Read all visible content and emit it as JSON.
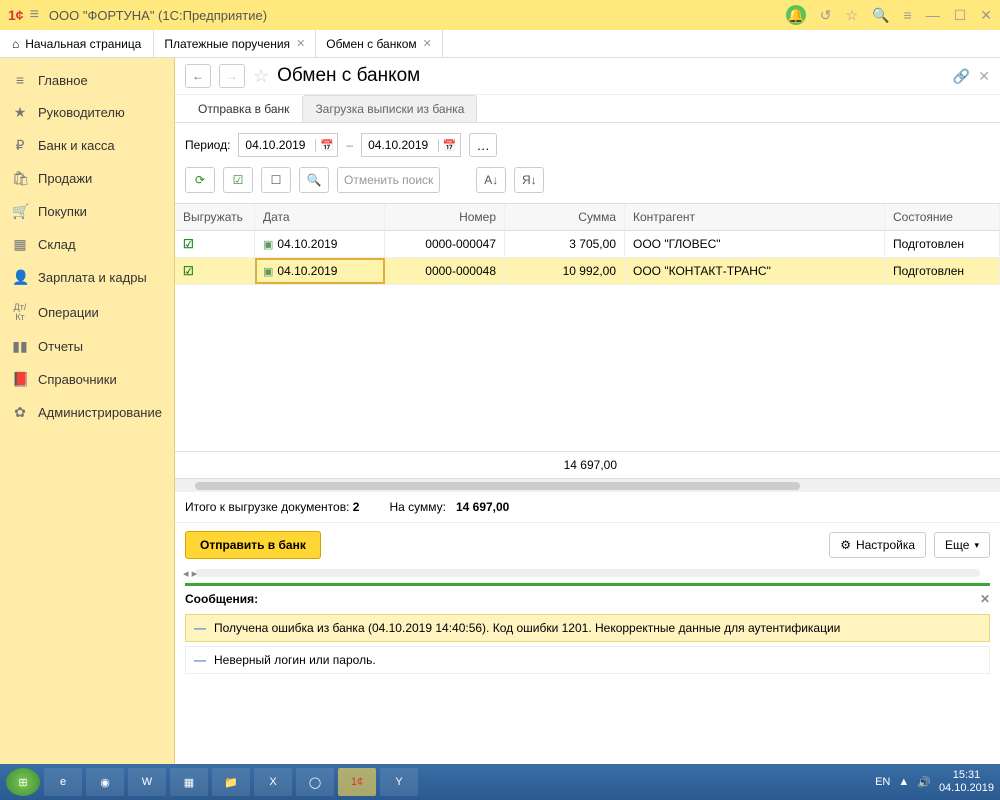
{
  "titlebar": {
    "logo": "1¢",
    "title": "ООО \"ФОРТУНА\"  (1С:Предприятие)"
  },
  "tabs": {
    "home": "Начальная страница",
    "items": [
      {
        "label": "Платежные поручения"
      },
      {
        "label": "Обмен с банком"
      }
    ]
  },
  "sidebar": {
    "items": [
      {
        "icon": "≡",
        "label": "Главное"
      },
      {
        "icon": "★",
        "label": "Руководителю"
      },
      {
        "icon": "₽",
        "label": "Банк и касса"
      },
      {
        "icon": "🛍",
        "label": "Продажи"
      },
      {
        "icon": "🛒",
        "label": "Покупки"
      },
      {
        "icon": "▦",
        "label": "Склад"
      },
      {
        "icon": "👤",
        "label": "Зарплата и кадры"
      },
      {
        "icon": "Дт/Кт",
        "label": "Операции"
      },
      {
        "icon": "▮▮",
        "label": "Отчеты"
      },
      {
        "icon": "📕",
        "label": "Справочники"
      },
      {
        "icon": "✿",
        "label": "Администрирование"
      }
    ]
  },
  "page": {
    "title": "Обмен с банком",
    "subtabs": {
      "active": "Отправка в банк",
      "inactive": "Загрузка выписки из банка"
    },
    "period": {
      "label": "Период:",
      "from": "04.10.2019",
      "to": "04.10.2019"
    },
    "toolbar": {
      "cancel_search": "Отменить поиск"
    },
    "grid": {
      "headers": {
        "export": "Выгружать",
        "date": "Дата",
        "number": "Номер",
        "sum": "Сумма",
        "contractor": "Контрагент",
        "state": "Состояние"
      },
      "rows": [
        {
          "date": "04.10.2019",
          "number": "0000-000047",
          "sum": "3 705,00",
          "contractor": "ООО \"ГЛОВЕС\"",
          "state": "Подготовлен"
        },
        {
          "date": "04.10.2019",
          "number": "0000-000048",
          "sum": "10 992,00",
          "contractor": "ООО  \"КОНТАКТ-ТРАНС\"",
          "state": "Подготовлен"
        }
      ],
      "total_sum": "14 697,00"
    },
    "summary": {
      "docs_label": "Итого к выгрузке документов:",
      "docs_count": "2",
      "sum_label": "На сумму:",
      "sum_value": "14 697,00"
    },
    "actions": {
      "send": "Отправить в банк",
      "settings": "Настройка",
      "more": "Еще"
    },
    "messages": {
      "title": "Сообщения:",
      "items": [
        "Получена ошибка из банка (04.10.2019 14:40:56). Код ошибки 1201. Некорректные данные для аутентификации",
        "Неверный логин или пароль."
      ]
    }
  },
  "taskbar": {
    "lang": "EN",
    "time": "15:31",
    "date": "04.10.2019"
  }
}
